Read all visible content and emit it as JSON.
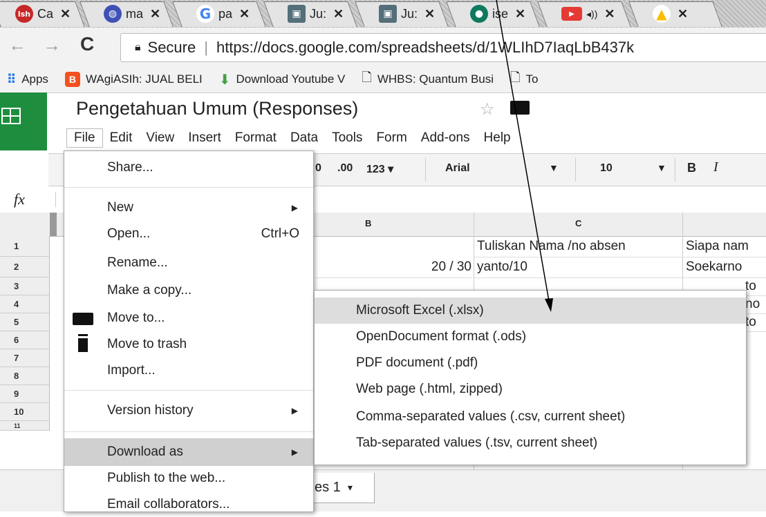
{
  "browser": {
    "tabs": [
      {
        "label": "Ca",
        "icon": "lsh-icon",
        "color": "#c62828",
        "glyph": "lsh"
      },
      {
        "label": "ma",
        "icon": "app-icon",
        "color": "#3f51b5",
        "glyph": "◍"
      },
      {
        "label": "pa",
        "icon": "google-icon",
        "color": "#4285f4",
        "glyph": "G"
      },
      {
        "label": "Ju:",
        "icon": "image-icon",
        "color": "#546e7a",
        "glyph": "▣"
      },
      {
        "label": "Ju:",
        "icon": "image-icon",
        "color": "#546e7a",
        "glyph": "▣"
      },
      {
        "label": "ise",
        "icon": "site-icon",
        "color": "#0d7a5f",
        "glyph": "●"
      },
      {
        "label": "",
        "icon": "youtube-icon",
        "color": "#e53935",
        "glyph": "▶"
      },
      {
        "label": "",
        "icon": "drive-icon",
        "color": "#fbbc04",
        "glyph": "▲"
      }
    ],
    "secure_label": "Secure",
    "url": "https://docs.google.com/spreadsheets/d/1WLIhD7IaqLbB437k",
    "bookmarks": [
      {
        "label": "Apps",
        "icon": "apps-grid-icon"
      },
      {
        "label": "WAgiASIh: JUAL BELI",
        "icon": "blogger-icon"
      },
      {
        "label": "Download Youtube V",
        "icon": "download-icon"
      },
      {
        "label": "WHBS: Quantum Busi",
        "icon": "page-icon"
      },
      {
        "label": "To",
        "icon": "page-icon"
      }
    ]
  },
  "doc": {
    "title": "Pengetahuan Umum (Responses)",
    "menus": [
      "File",
      "Edit",
      "View",
      "Insert",
      "Format",
      "Data",
      "Tools",
      "Form",
      "Add-ons",
      "Help"
    ]
  },
  "toolbar": {
    "decimal_less": "0",
    "decimal_more": ".00",
    "format_123": "123",
    "font": "Arial",
    "size": "10",
    "bold": "B",
    "italic": "I"
  },
  "formula": {
    "fx": "fx"
  },
  "grid": {
    "col_b": "B",
    "col_c": "C",
    "rows": [
      "1",
      "2",
      "3",
      "4",
      "5",
      "6",
      "7",
      "8",
      "9",
      "10",
      "11"
    ],
    "c1": "Tuliskan Nama /no absen",
    "d1": "Siapa nam",
    "b2": "20 / 30",
    "c2": "yanto/10",
    "d2": "Soekarno",
    "d3": "to",
    "d4": "no",
    "d5": "to"
  },
  "file_menu": {
    "share": "Share...",
    "new": "New",
    "open": "Open...",
    "open_shortcut": "Ctrl+O",
    "rename": "Rename...",
    "copy": "Make a copy...",
    "move": "Move to...",
    "trash": "Move to trash",
    "import": "Import...",
    "version": "Version history",
    "download": "Download as",
    "publish": "Publish to the web...",
    "email": "Email collaborators..."
  },
  "download_menu": [
    "Microsoft Excel (.xlsx)",
    "OpenDocument format (.ods)",
    "PDF document (.pdf)",
    "Web page (.html, zipped)",
    "Comma-separated values (.csv, current sheet)",
    "Tab-separated values (.tsv, current sheet)"
  ],
  "sheet_tab": "es 1"
}
